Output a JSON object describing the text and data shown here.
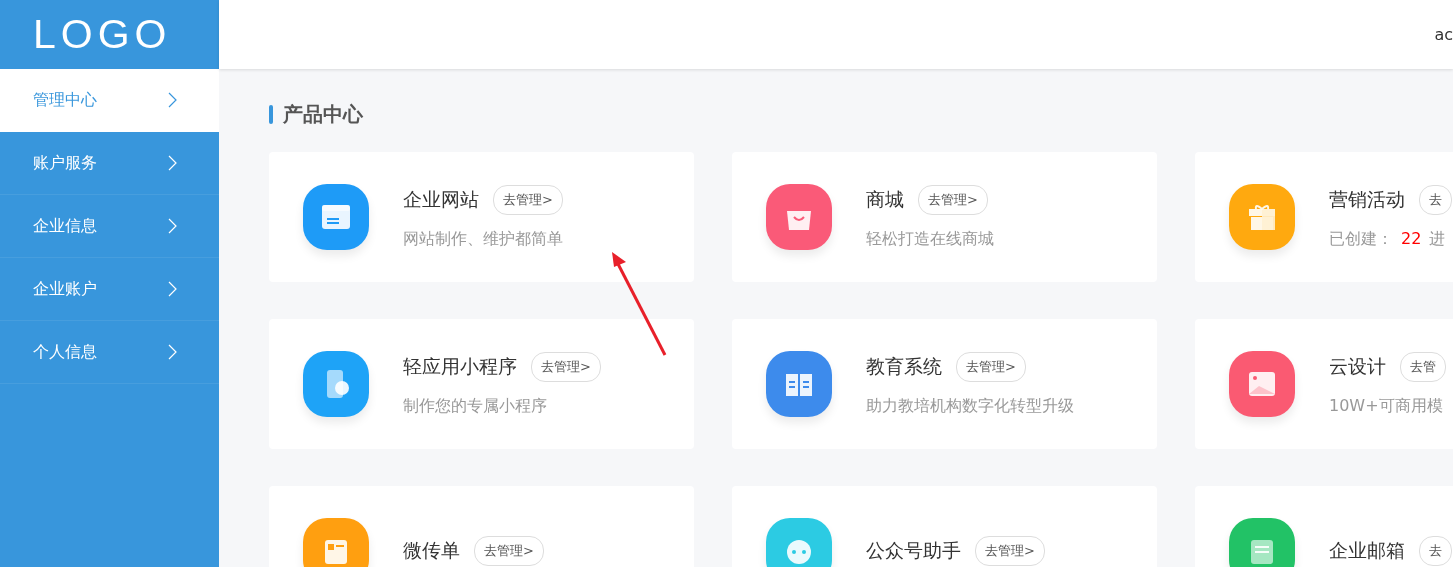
{
  "logo": "LOGO",
  "header": {
    "user": "ac"
  },
  "sidebar": {
    "items": [
      {
        "label": "管理中心",
        "selected": true
      },
      {
        "label": "账户服务",
        "selected": false
      },
      {
        "label": "企业信息",
        "selected": false
      },
      {
        "label": "企业账户",
        "selected": false
      },
      {
        "label": "个人信息",
        "selected": false
      }
    ]
  },
  "section_title": "产品中心",
  "cards": [
    {
      "title": "企业网站",
      "button": "去管理>",
      "kind": "text",
      "description": "网站制作、维护都简单",
      "color": "#1e9bf7"
    },
    {
      "title": "商城",
      "button": "去管理>",
      "kind": "text",
      "description": "轻松打造在线商城",
      "color": "#fa5a78"
    },
    {
      "title": "营销活动",
      "button": "去",
      "kind": "stats",
      "stats": {
        "label": "已创建：",
        "count": "22",
        "next": "进"
      },
      "color": "#ffa90f"
    },
    {
      "title": "轻应用小程序",
      "button": "去管理>",
      "kind": "text",
      "description": "制作您的专属小程序",
      "color": "#1ea3f7"
    },
    {
      "title": "教育系统",
      "button": "去管理>",
      "kind": "text",
      "description": "助力教培机构数字化转型升级",
      "color": "#3d8bec"
    },
    {
      "title": "云设计",
      "button": "去管",
      "kind": "text",
      "description": "10W+可商用模",
      "color": "#fa5a72"
    },
    {
      "title": "微传单",
      "button": "去管理>",
      "kind": "text",
      "color": "#ff9f10"
    },
    {
      "title": "公众号助手",
      "button": "去管理>",
      "kind": "text",
      "color": "#2ccbe3"
    },
    {
      "title": "企业邮箱",
      "button": "去",
      "kind": "text",
      "color": "#22c266"
    }
  ]
}
